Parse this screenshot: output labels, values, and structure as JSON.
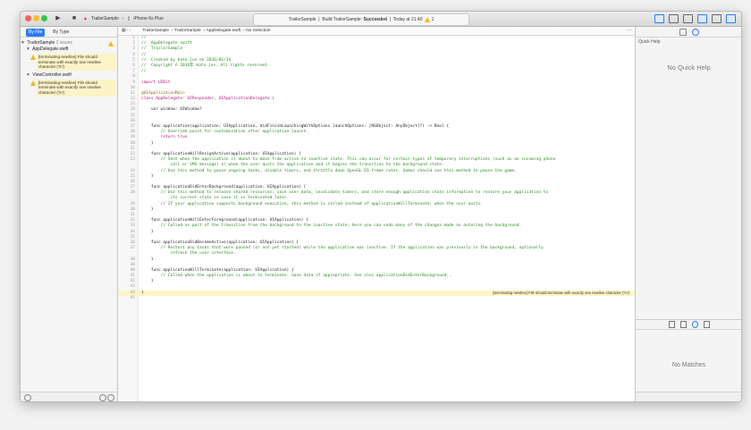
{
  "toolbar": {
    "scheme_project": "TrailorSample",
    "scheme_device": "iPhone 6s Plus",
    "activity_project": "TrailorSample",
    "activity_prefix": "Build TrailorSample:",
    "activity_status": "Succeeded",
    "activity_time": "Today at 21:40",
    "warning_count": "1"
  },
  "navigator": {
    "tabs": [
      "By File",
      "By Type"
    ],
    "project": "TrailorSample",
    "project_count": "2 issues",
    "files": [
      {
        "name": "AppDelegate.swift",
        "issue": "[terminating-newline] File should terminate with exactly one newline character ('\\n')"
      },
      {
        "name": "ViewController.swift",
        "issue": "[terminating-newline] File should terminate with exactly one newline character ('\\n')"
      }
    ]
  },
  "jumpbar": {
    "crumbs": [
      "TrailorSample",
      "TrailorSample",
      "AppDelegate.swift",
      "No Selection"
    ]
  },
  "editor": {
    "warning_line": "44",
    "warning_message": "[terminating-newline] File should terminate with exactly one newline character ('\\n')",
    "lines": [
      {
        "n": "1",
        "t": "//",
        "k": "c"
      },
      {
        "n": "2",
        "t": "//  AppDelegate.swift",
        "k": "c"
      },
      {
        "n": "3",
        "t": "//  TrailorSample",
        "k": "c"
      },
      {
        "n": "4",
        "t": "//",
        "k": "c"
      },
      {
        "n": "5",
        "t": "//  Created by kato.jun on 2016/01/14.",
        "k": "c"
      },
      {
        "n": "6",
        "t": "//  Copyright © 2016年 kato.jun. All rights reserved.",
        "k": "c"
      },
      {
        "n": "7",
        "t": "//",
        "k": "c"
      },
      {
        "n": "8",
        "t": "",
        "k": ""
      },
      {
        "n": "9",
        "t": "import UIKit",
        "k": "kw"
      },
      {
        "n": "10",
        "t": "",
        "k": ""
      },
      {
        "n": "11",
        "t": "@UIApplicationMain",
        "k": "attr"
      },
      {
        "n": "12",
        "t": "class AppDelegate: UIResponder, UIApplicationDelegate {",
        "k": "kw"
      },
      {
        "n": "13",
        "t": "",
        "k": ""
      },
      {
        "n": "14",
        "t": "    var window: UIWindow?",
        "k": ""
      },
      {
        "n": "15",
        "t": "",
        "k": ""
      },
      {
        "n": "16",
        "t": "",
        "k": ""
      },
      {
        "n": "17",
        "t": "    func application(application: UIApplication, didFinishLaunchingWithOptions launchOptions: [NSObject: AnyObject]?) -> Bool {",
        "k": ""
      },
      {
        "n": "18",
        "t": "        // Override point for customization after application launch.",
        "k": "c"
      },
      {
        "n": "19",
        "t": "        return true",
        "k": "kw"
      },
      {
        "n": "20",
        "t": "    }",
        "k": ""
      },
      {
        "n": "21",
        "t": "",
        "k": ""
      },
      {
        "n": "22",
        "t": "    func applicationWillResignActive(application: UIApplication) {",
        "k": ""
      },
      {
        "n": "23",
        "t": "        // Sent when the application is about to move from active to inactive state. This can occur for certain types of temporary interruptions (such as an incoming phone",
        "k": "c"
      },
      {
        "n": "",
        "t": "            call or SMS message) or when the user quits the application and it begins the transition to the background state.",
        "k": "c"
      },
      {
        "n": "24",
        "t": "        // Use this method to pause ongoing tasks, disable timers, and throttle down OpenGL ES frame rates. Games should use this method to pause the game.",
        "k": "c"
      },
      {
        "n": "25",
        "t": "    }",
        "k": ""
      },
      {
        "n": "26",
        "t": "",
        "k": ""
      },
      {
        "n": "27",
        "t": "    func applicationDidEnterBackground(application: UIApplication) {",
        "k": ""
      },
      {
        "n": "28",
        "t": "        // Use this method to release shared resources, save user data, invalidate timers, and store enough application state information to restore your application to",
        "k": "c"
      },
      {
        "n": "",
        "t": "            its current state in case it is terminated later.",
        "k": "c"
      },
      {
        "n": "29",
        "t": "        // If your application supports background execution, this method is called instead of applicationWillTerminate: when the user quits.",
        "k": "c"
      },
      {
        "n": "30",
        "t": "    }",
        "k": ""
      },
      {
        "n": "31",
        "t": "",
        "k": ""
      },
      {
        "n": "32",
        "t": "    func applicationWillEnterForeground(application: UIApplication) {",
        "k": ""
      },
      {
        "n": "33",
        "t": "        // Called as part of the transition from the background to the inactive state; here you can undo many of the changes made on entering the background.",
        "k": "c"
      },
      {
        "n": "34",
        "t": "    }",
        "k": ""
      },
      {
        "n": "35",
        "t": "",
        "k": ""
      },
      {
        "n": "36",
        "t": "    func applicationDidBecomeActive(application: UIApplication) {",
        "k": ""
      },
      {
        "n": "37",
        "t": "        // Restart any tasks that were paused (or not yet started) while the application was inactive. If the application was previously in the background, optionally",
        "k": "c"
      },
      {
        "n": "",
        "t": "            refresh the user interface.",
        "k": "c"
      },
      {
        "n": "38",
        "t": "    }",
        "k": ""
      },
      {
        "n": "39",
        "t": "",
        "k": ""
      },
      {
        "n": "40",
        "t": "    func applicationWillTerminate(application: UIApplication) {",
        "k": ""
      },
      {
        "n": "41",
        "t": "        // Called when the application is about to terminate. Save data if appropriate. See also applicationDidEnterBackground:.",
        "k": "c"
      },
      {
        "n": "42",
        "t": "    }",
        "k": ""
      },
      {
        "n": "43",
        "t": "",
        "k": ""
      },
      {
        "n": "44",
        "t": "}",
        "k": "",
        "warn": true
      },
      {
        "n": "45",
        "t": "",
        "k": ""
      }
    ]
  },
  "inspector": {
    "title": "Quick Help",
    "empty": "No Quick Help",
    "library_empty": "No Matches"
  },
  "colors": {
    "accent": "#2b7cf6",
    "warning": "#f3b81c",
    "comment": "#2e8a24",
    "keyword": "#b5157b"
  }
}
